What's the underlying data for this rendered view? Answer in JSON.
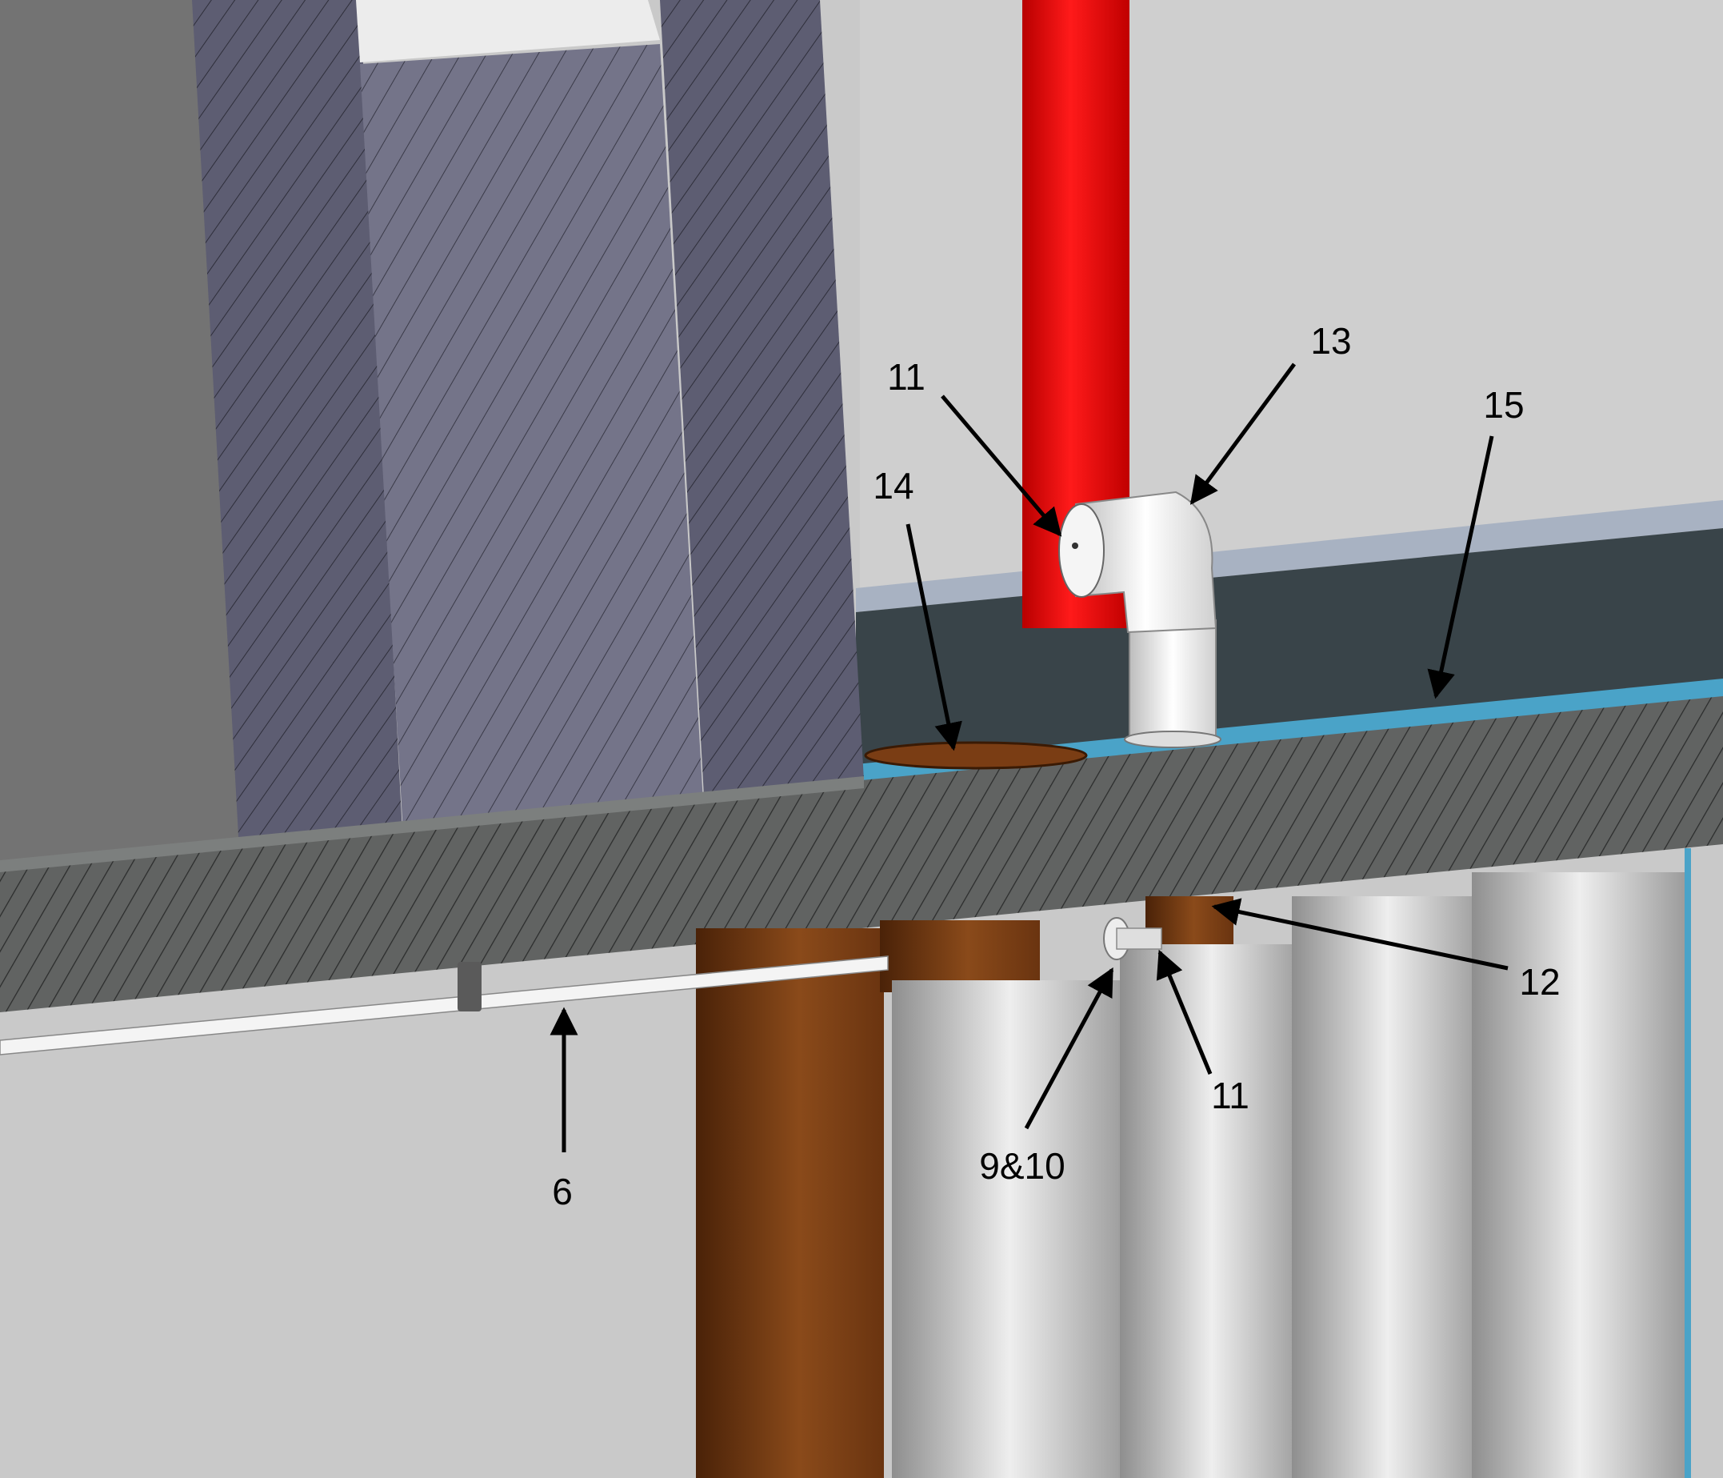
{
  "figure": {
    "callouts": [
      {
        "id": "label-11-top",
        "text": "11"
      },
      {
        "id": "label-13",
        "text": "13"
      },
      {
        "id": "label-15",
        "text": "15"
      },
      {
        "id": "label-14",
        "text": "14"
      },
      {
        "id": "label-12",
        "text": "12"
      },
      {
        "id": "label-11-bottom",
        "text": "11"
      },
      {
        "id": "label-9-10",
        "text": "9&10"
      },
      {
        "id": "label-6",
        "text": "6"
      }
    ]
  },
  "colors": {
    "background_wall": "#c6c6c6",
    "hatched_block": "#5d5d72",
    "hatched_block_light": "#73738a",
    "slab": "#5f6160",
    "red_pipe": "#e01010",
    "copper_pipe": "#7a3d14",
    "white_fittings": "#f0f0f0",
    "blue_trim": "#4aa3c8",
    "dark_channel": "#394449"
  }
}
